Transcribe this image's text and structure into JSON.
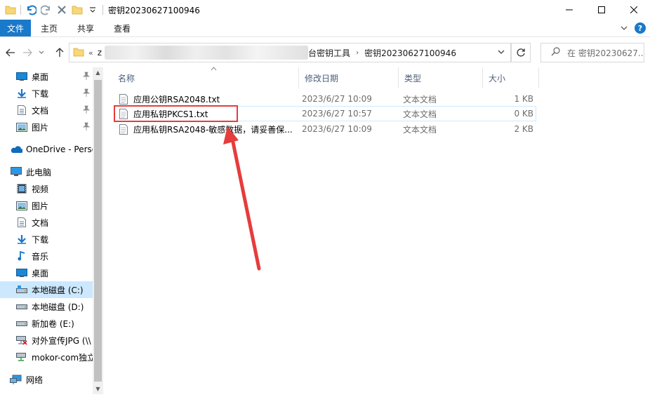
{
  "window": {
    "title": "密钥20230627100946",
    "controls": {
      "minimize": "─",
      "maximize": "☐",
      "close": "✕"
    }
  },
  "ribbon": {
    "tabs": [
      {
        "label": "文件",
        "active": true
      },
      {
        "label": "主页"
      },
      {
        "label": "共享"
      },
      {
        "label": "查看"
      }
    ],
    "help": "?"
  },
  "address": {
    "overflow": "«",
    "partial_first": "z",
    "crumbs": [
      "台密钥工具",
      "密钥20230627100946"
    ]
  },
  "search": {
    "placeholder": "在 密钥20230627..."
  },
  "nav": {
    "quick_access": [
      {
        "label": "桌面",
        "icon": "desktop-icon",
        "pinned": true
      },
      {
        "label": "下载",
        "icon": "download-icon",
        "pinned": true
      },
      {
        "label": "文档",
        "icon": "document-icon",
        "pinned": true
      },
      {
        "label": "图片",
        "icon": "picture-icon",
        "pinned": true
      }
    ],
    "onedrive": "OneDrive - Perso",
    "this_pc": "此电脑",
    "pc_items": [
      {
        "label": "视频",
        "icon": "video-icon"
      },
      {
        "label": "图片",
        "icon": "picture-icon"
      },
      {
        "label": "文档",
        "icon": "document-icon"
      },
      {
        "label": "下载",
        "icon": "download-icon"
      },
      {
        "label": "音乐",
        "icon": "music-icon"
      },
      {
        "label": "桌面",
        "icon": "desktop-icon"
      },
      {
        "label": "本地磁盘 (C:)",
        "icon": "drive-c-icon",
        "selected": true
      },
      {
        "label": "本地磁盘 (D:)",
        "icon": "drive-icon"
      },
      {
        "label": "新加卷 (E:)",
        "icon": "drive-icon"
      },
      {
        "label": "对外宣传JPG (\\\\",
        "icon": "network-drive-disconnected-icon"
      },
      {
        "label": "mokor-com独立",
        "icon": "network-drive-icon"
      }
    ],
    "network": "网络"
  },
  "columns": {
    "name": "名称",
    "modified": "修改日期",
    "type": "类型",
    "size": "大小"
  },
  "files": [
    {
      "name": "应用公钥RSA2048.txt",
      "modified": "2023/6/27 10:09",
      "type": "文本文档",
      "size": "1 KB"
    },
    {
      "name": "应用私钥PKCS1.txt",
      "modified": "2023/6/27 10:57",
      "type": "文本文档",
      "size": "0 KB",
      "selected": true
    },
    {
      "name": "应用私钥RSA2048-敏感数据，请妥善保...",
      "modified": "2023/6/27 10:09",
      "type": "文本文档",
      "size": "2 KB"
    }
  ],
  "annotation_color": "#e63c3c"
}
